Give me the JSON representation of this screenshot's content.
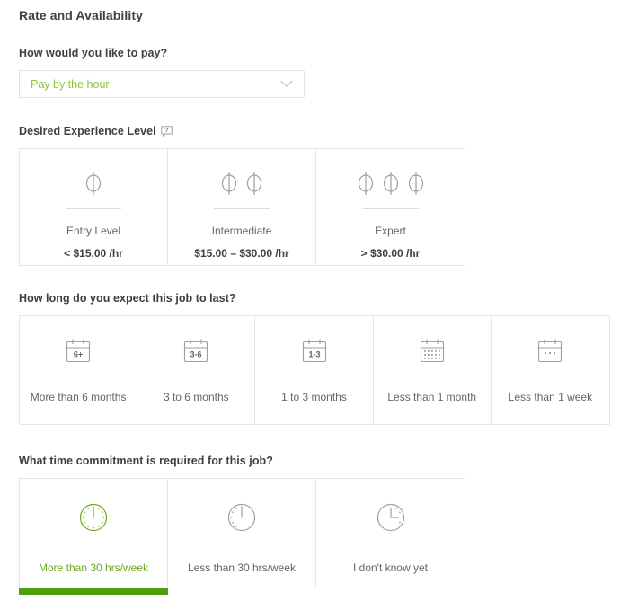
{
  "page_title": "Rate and Availability",
  "colors": {
    "accent_green": "#8dc63f",
    "selected_text_green": "#6fa824",
    "selected_bar_green": "#4d9f0c",
    "icon_gray": "#9aa0a6",
    "border_gray": "#e6e6e6",
    "text_dark": "#3c4146",
    "text_muted": "#60666c"
  },
  "pay": {
    "label": "How would you like to pay?",
    "selected_value": "Pay by the hour",
    "chevron_icon": "chevron-down-icon",
    "options": [
      "Pay by the hour"
    ]
  },
  "experience": {
    "label": "Desired Experience Level",
    "help_icon": "question-tooltip-icon",
    "cards": [
      {
        "icon": "dollar-sign-icon",
        "dollar_count": 1,
        "title": "Entry Level",
        "subtitle": "< $15.00 /hr",
        "selected": false
      },
      {
        "icon": "dollar-sign-icon",
        "dollar_count": 2,
        "title": "Intermediate",
        "subtitle": "$15.00 – $30.00 /hr",
        "selected": false
      },
      {
        "icon": "dollar-sign-icon",
        "dollar_count": 3,
        "title": "Expert",
        "subtitle": "> $30.00 /hr",
        "selected": false
      }
    ]
  },
  "duration": {
    "label": "How long do you expect this job to last?",
    "cards": [
      {
        "icon": "calendar-icon",
        "badge": "6+",
        "title": "More than 6 months",
        "selected": false
      },
      {
        "icon": "calendar-icon",
        "badge": "3-6",
        "title": "3 to 6 months",
        "selected": false
      },
      {
        "icon": "calendar-icon",
        "badge": "1-3",
        "title": "1 to 3 months",
        "selected": false
      },
      {
        "icon": "calendar-icon",
        "badge": "",
        "title": "Less than 1 month",
        "selected": false
      },
      {
        "icon": "calendar-icon",
        "badge": "",
        "title": "Less than 1 week",
        "selected": false
      }
    ]
  },
  "commitment": {
    "label": "What time commitment is required for this job?",
    "cards": [
      {
        "icon": "clock-icon",
        "title": "More than 30 hrs/week",
        "selected": true
      },
      {
        "icon": "clock-icon",
        "title": "Less than 30 hrs/week",
        "selected": false
      },
      {
        "icon": "clock-icon",
        "title": "I don't know yet",
        "selected": false
      }
    ]
  }
}
